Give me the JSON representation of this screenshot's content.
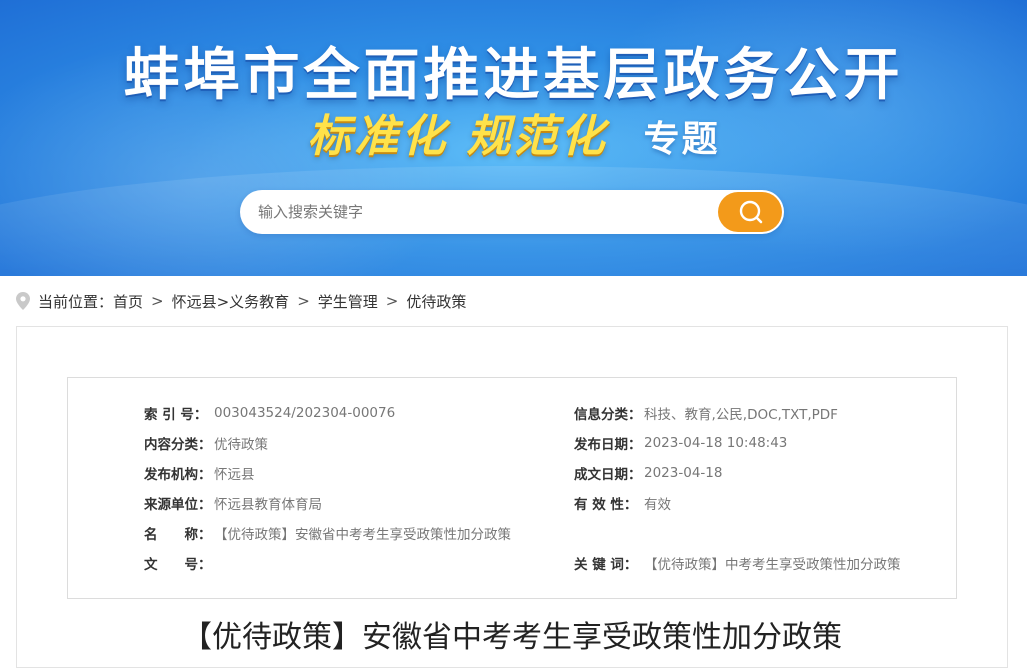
{
  "banner": {
    "title": "蚌埠市全面推进基层政务公开",
    "subtitle_gold": "标准化  规范化",
    "subtitle_white": "专题"
  },
  "search": {
    "placeholder": "输入搜索关键字",
    "value": ""
  },
  "breadcrumb": {
    "prefix": "当前位置：",
    "items": [
      "首页",
      "怀远县>义务教育",
      "学生管理",
      "优待政策"
    ]
  },
  "meta": {
    "index_no": {
      "label": "索 引 号：",
      "value": "003043524/202304-00076"
    },
    "info_class": {
      "label": "信息分类：",
      "value": "科技、教育,公民,DOC,TXT,PDF"
    },
    "content_class": {
      "label": "内容分类：",
      "value": "优待政策"
    },
    "publish_date": {
      "label": "发布日期：",
      "value": "2023-04-18 10:48:43"
    },
    "publisher": {
      "label": "发布机构：",
      "value": "怀远县"
    },
    "written_date": {
      "label": "成文日期：",
      "value": "2023-04-18"
    },
    "source": {
      "label": "来源单位：",
      "value": "怀远县教育体育局"
    },
    "validity": {
      "label": "有 效 性：",
      "value": "有效"
    },
    "name": {
      "label": "名　　称：",
      "value": "【优待政策】安徽省中考考生享受政策性加分政策"
    },
    "doc_no": {
      "label": "文　　号：",
      "value": ""
    },
    "keywords": {
      "label": "关 键 词：",
      "value": "【优待政策】中考考生享受政策性加分政策"
    }
  },
  "article": {
    "title": "【优待政策】安徽省中考考生享受政策性加分政策"
  },
  "colors": {
    "banner_blue": "#2f8fe6",
    "search_button": "#f39a1a",
    "gold_text": "#ffe24a"
  }
}
